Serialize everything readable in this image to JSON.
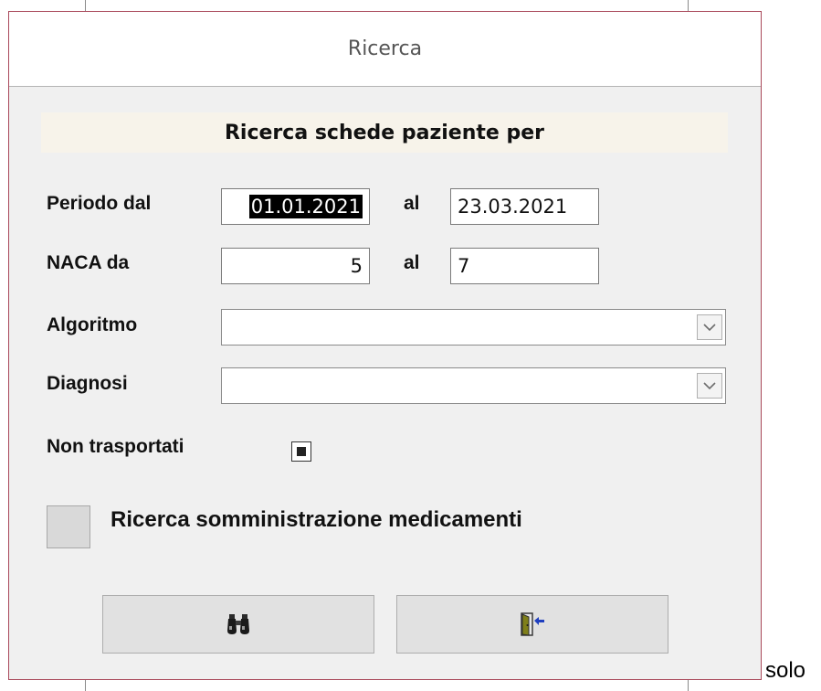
{
  "window": {
    "title": "Ricerca"
  },
  "banner": {
    "text": "Ricerca schede paziente per"
  },
  "period": {
    "label": "Periodo dal",
    "from_value": "01.01.2021",
    "to_label": "al",
    "to_value": "23.03.2021"
  },
  "naca": {
    "label": "NACA da",
    "from_value": "5",
    "to_label": "al",
    "to_value": "7"
  },
  "algoritmo": {
    "label": "Algoritmo",
    "value": ""
  },
  "diagnosi": {
    "label": "Diagnosi",
    "value": ""
  },
  "non_trasportati": {
    "label": "Non trasportati",
    "state": "indeterminate"
  },
  "medicamenti": {
    "label": "Ricerca somministrazione medicamenti",
    "checked": false
  },
  "buttons": {
    "search_icon": "binoculars-icon",
    "exit_icon": "exit-door-icon"
  },
  "outside": {
    "text": "solo"
  },
  "colors": {
    "dialog_border": "#a9485a",
    "banner_bg": "#f7f3ea",
    "icon_blue": "#1f3fbf"
  }
}
